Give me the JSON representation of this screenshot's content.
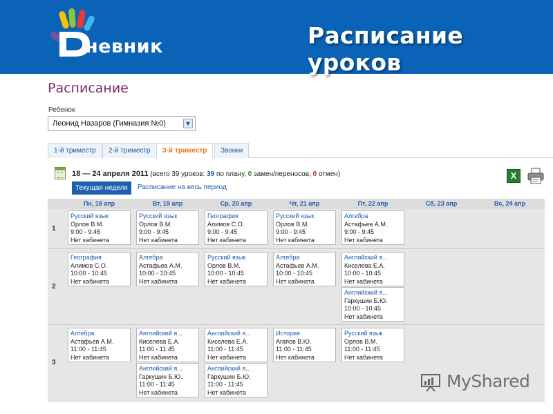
{
  "header": {
    "logo_text": "невник",
    "slide_title": "Расписание уроков"
  },
  "page": {
    "title": "Расписание",
    "child_label": "Ребенок",
    "child_selected": "Леонид Назаров (Гимназия №0)"
  },
  "tabs": [
    {
      "label": "1-й триместр",
      "active": false
    },
    {
      "label": "2-й триместр",
      "active": false
    },
    {
      "label": "3-й триместр",
      "active": true
    },
    {
      "label": "Звонки",
      "active": false
    }
  ],
  "week": {
    "range": "18 — 24 апреля 2011",
    "prefix": "(всего",
    "total": "39",
    "total_word": "уроков:",
    "planned": "39",
    "planned_word": "по плану,",
    "changes": "0",
    "changes_word": "замен/переносов,",
    "cancels": "0",
    "cancels_word": "отмен)",
    "current_week_button": "Текущая неделя",
    "full_period_link": "Расписание на весь период"
  },
  "days": [
    "Пн, 18 апр",
    "Вт, 19 апр",
    "Ср, 20 апр",
    "Чт, 21 апр",
    "Пт, 22 апр",
    "Сб, 23 апр",
    "Вс, 24 апр"
  ],
  "rows": [
    "1",
    "2",
    "3"
  ],
  "lessons": [
    {
      "row": 0,
      "day": 0,
      "slot": 0,
      "subject": "Русский язык",
      "teacher": "Орлов В.М.",
      "time": "9:00 - 9:45",
      "room": "Нет кабинета"
    },
    {
      "row": 0,
      "day": 1,
      "slot": 0,
      "subject": "Русский язык",
      "teacher": "Орлов В.М.",
      "time": "9:00 - 9:45",
      "room": "Нет кабинета"
    },
    {
      "row": 0,
      "day": 2,
      "slot": 0,
      "subject": "География",
      "teacher": "Алимов С.О.",
      "time": "9:00 - 9:45",
      "room": "Нет кабинета"
    },
    {
      "row": 0,
      "day": 3,
      "slot": 0,
      "subject": "Русский язык",
      "teacher": "Орлов В.М.",
      "time": "9:00 - 9:45",
      "room": "Нет кабинета"
    },
    {
      "row": 0,
      "day": 4,
      "slot": 0,
      "subject": "Алгебра",
      "teacher": "Астафьев А.М.",
      "time": "9:00 - 9:45",
      "room": "Нет кабинета"
    },
    {
      "row": 1,
      "day": 0,
      "slot": 0,
      "subject": "География",
      "teacher": "Алимов С.О.",
      "time": "10:00 - 10:45",
      "room": "Нет кабинета"
    },
    {
      "row": 1,
      "day": 1,
      "slot": 0,
      "subject": "Алгебра",
      "teacher": "Астафьев А.М.",
      "time": "10:00 - 10:45",
      "room": "Нет кабинета"
    },
    {
      "row": 1,
      "day": 2,
      "slot": 0,
      "subject": "Русский язык",
      "teacher": "Орлов В.М.",
      "time": "10:00 - 10:45",
      "room": "Нет кабинета"
    },
    {
      "row": 1,
      "day": 3,
      "slot": 0,
      "subject": "Алгебра",
      "teacher": "Астафьев А.М.",
      "time": "10:00 - 10:45",
      "room": "Нет кабинета"
    },
    {
      "row": 1,
      "day": 4,
      "slot": 0,
      "subject": "Английский я...",
      "teacher": "Киселева Е.А.",
      "time": "10:00 - 10:45",
      "room": "Нет кабинета"
    },
    {
      "row": 1,
      "day": 4,
      "slot": 1,
      "subject": "Английский я...",
      "teacher": "Гаркушин Б.Ю.",
      "time": "10:00 - 10:45",
      "room": "Нет кабинета"
    },
    {
      "row": 2,
      "day": 0,
      "slot": 0,
      "subject": "Алгебра",
      "teacher": "Астафьев А.М.",
      "time": "11:00 - 11:45",
      "room": "Нет кабинета"
    },
    {
      "row": 2,
      "day": 1,
      "slot": 0,
      "subject": "Английский я...",
      "teacher": "Киселева Е.А.",
      "time": "11:00 - 11:45",
      "room": "Нет кабинета"
    },
    {
      "row": 2,
      "day": 1,
      "slot": 1,
      "subject": "Английский я...",
      "teacher": "Гаркушин Б.Ю.",
      "time": "11:00 - 11:45",
      "room": "Нет кабинета"
    },
    {
      "row": 2,
      "day": 2,
      "slot": 0,
      "subject": "Английский я...",
      "teacher": "Киселева Е.А.",
      "time": "11:00 - 11:45",
      "room": "Нет кабинета"
    },
    {
      "row": 2,
      "day": 2,
      "slot": 1,
      "subject": "Английский я...",
      "teacher": "Гаркушин Б.Ю.",
      "time": "11:00 - 11:45",
      "room": "Нет кабинета"
    },
    {
      "row": 2,
      "day": 3,
      "slot": 0,
      "subject": "История",
      "teacher": "Агапов В.Ю.",
      "time": "11:00 - 11:45",
      "room": "Нет кабинета"
    },
    {
      "row": 2,
      "day": 4,
      "slot": 0,
      "subject": "Русский язык",
      "teacher": "Орлов В.М.",
      "time": "11:00 - 11:45",
      "room": "Нет кабинета"
    }
  ],
  "watermark": {
    "text": "MyShared"
  },
  "colors": {
    "header_bg": "#0a63b6",
    "link": "#1a5ca8",
    "active_tab": "#e8761a",
    "title": "#7a2a6b"
  }
}
